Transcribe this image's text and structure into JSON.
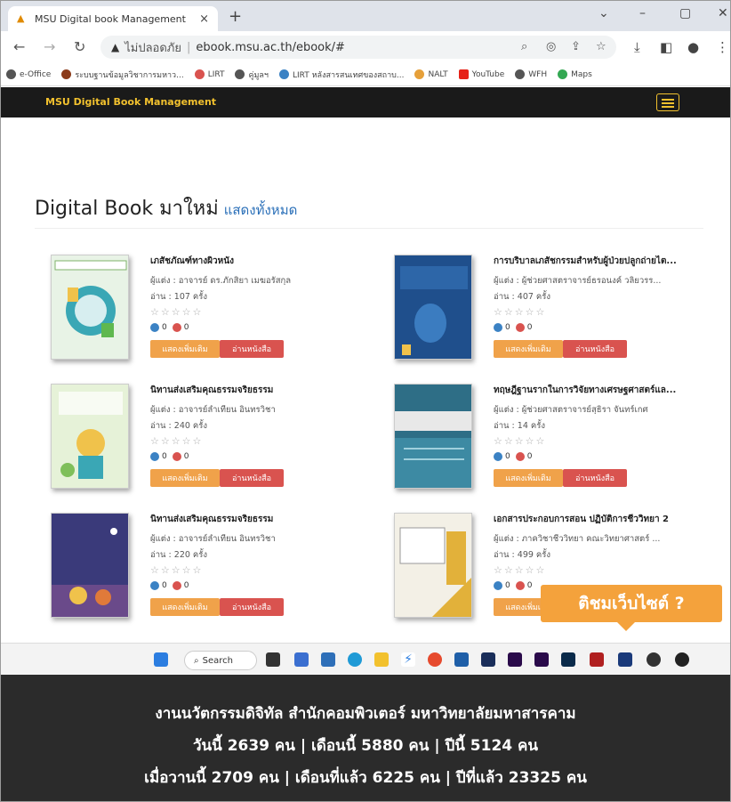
{
  "browser": {
    "tab_title": "MSU Digital book Management",
    "tab_close": "×",
    "new_tab": "+",
    "security_label": "ไม่ปลอดภัย",
    "url": "ebook.msu.ac.th/ebook/#"
  },
  "bookmarks": [
    {
      "label": "e-Office",
      "color": "#555555"
    },
    {
      "label": "ระบบฐานข้อมูลวิชาการมหาว...",
      "color": "#8b3b1a"
    },
    {
      "label": "LIRT",
      "color": "#d9534f"
    },
    {
      "label": "คู่มูลฯ",
      "color": "#555555"
    },
    {
      "label": "LIRT หลังสารสนเทศของสถาบ...",
      "color": "#3b82c4"
    },
    {
      "label": "NALT",
      "color": "#e6a03a"
    },
    {
      "label": "YouTube",
      "color": "#e62117"
    },
    {
      "label": "WFH",
      "color": "#555555"
    },
    {
      "label": "Maps",
      "color": "#34a853"
    }
  ],
  "site": {
    "brand": "MSU Digital Book Management",
    "heading": "Digital Book มาใหม่",
    "show_all": "แสดงทั้งหมด"
  },
  "books": [
    {
      "title": "เภสัชภัณฑ์ทางผิวหนัง",
      "author": "ผู้แต่ง : อาจารย์ ดร.ภักสิยา เมฆอรัสกุล",
      "reads": "อ่าน : 107 ครั้ง",
      "likes": "0",
      "dislikes": "0",
      "cover": "#e8f3e6"
    },
    {
      "title": "การบริบาลเภสัชกรรมสำหรับผู้ป่วยปลูกถ่ายไต...",
      "author": "ผู้แต่ง : ผู้ช่วยศาสตราจารย์ธรอนงค์ วลิยวรร...",
      "reads": "อ่าน : 407 ครั้ง",
      "likes": "0",
      "dislikes": "0",
      "cover": "#1f4f8c"
    },
    {
      "title": "นิทานส่งเสริมคุณธรรมจริยธรรม",
      "author": "ผู้แต่ง : อาจารย์ลำเทียน อินทรวิชา",
      "reads": "อ่าน : 240 ครั้ง",
      "likes": "0",
      "dislikes": "0",
      "cover": "#e6f2d8"
    },
    {
      "title": "ทฤษฎีฐานรากในการวิจัยทางเศรษฐศาสตร์แล...",
      "author": "ผู้แต่ง : ผู้ช่วยศาสตราจารย์สุธิรา จันทร์เกศ",
      "reads": "อ่าน : 14 ครั้ง",
      "likes": "0",
      "dislikes": "0",
      "cover": "#2e6e86"
    },
    {
      "title": "นิทานส่งเสริมคุณธรรมจริยธรรม",
      "author": "ผู้แต่ง : อาจารย์ลำเทียน อินทรวิชา",
      "reads": "อ่าน : 220 ครั้ง",
      "likes": "0",
      "dislikes": "0",
      "cover": "#3a3a7a"
    },
    {
      "title": "เอกสารประกอบการสอน ปฏิบัติการชีววิทยา 2",
      "author": "ผู้แต่ง : ภาควิชาชีววิทยา คณะวิทยาศาสตร์ ...",
      "reads": "อ่าน : 499 ครั้ง",
      "likes": "0",
      "dislikes": "0",
      "cover": "#f3f0e6"
    }
  ],
  "buttons": {
    "more": "แสดงเพิ่มเติม",
    "read": "อ่านหนังสือ"
  },
  "stars": "☆☆☆☆☆",
  "popup": "ติชมเว็บไซต์ ?",
  "taskbar": {
    "search": "Search"
  },
  "footer": {
    "line1": "งานนวัตกรรมดิจิทัล สำนักคอมพิวเตอร์ มหาวิทยาลัยมหาสารคาม",
    "line2": "วันนี้ 2639 คน | เดือนนี้ 5880 คน | ปีนี้ 5124 คน",
    "line3": "เมื่อวานนี้ 2709 คน | เดือนที่แล้ว 6225 คน | ปีที่แล้ว 23325 คน"
  }
}
